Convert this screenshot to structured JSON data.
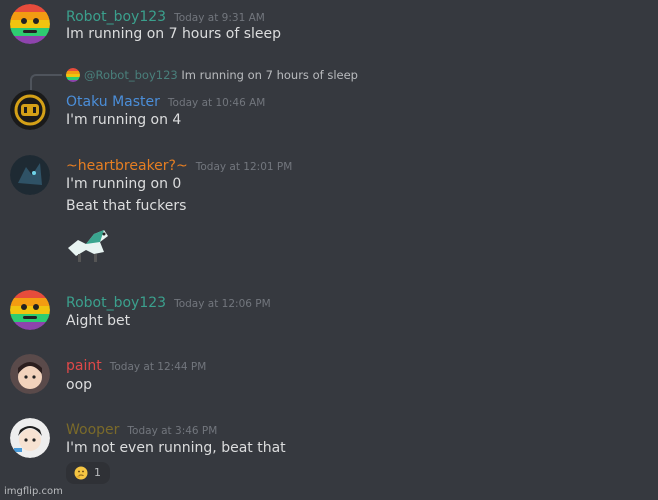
{
  "colors": {
    "background": "#36393f",
    "robot": "#3ba08d",
    "otaku": "#4b8ed9",
    "heart": "#e67e22",
    "paint": "#e04848",
    "wooper": "#7a6a2a"
  },
  "messages": [
    {
      "username": "Robot_boy123",
      "timestamp": "Today at 9:31 AM",
      "lines": [
        "Im running on 7 hours of sleep"
      ]
    },
    {
      "reply": {
        "mention": "@Robot_boy123",
        "text": "Im running on 7 hours of sleep"
      },
      "username": "Otaku Master",
      "timestamp": "Today at 10:46 AM",
      "lines": [
        "I'm running on 4"
      ]
    },
    {
      "username": "~heartbreaker?~",
      "timestamp": "Today at 12:01 PM",
      "lines": [
        "I'm running on 0",
        "Beat that fuckers"
      ],
      "sticker": "dragon-sticker"
    },
    {
      "username": "Robot_boy123",
      "timestamp": "Today at 12:06 PM",
      "lines": [
        "Aight bet"
      ]
    },
    {
      "username": "paint",
      "timestamp": "Today at 12:44 PM",
      "lines": [
        "oop"
      ]
    },
    {
      "username": "Wooper",
      "timestamp": "Today at 3:46 PM",
      "lines": [
        "I'm not even running, beat that"
      ],
      "reaction": {
        "emoji": "thinking-emoji",
        "count": "1"
      }
    }
  ],
  "watermark": "imgflip.com"
}
